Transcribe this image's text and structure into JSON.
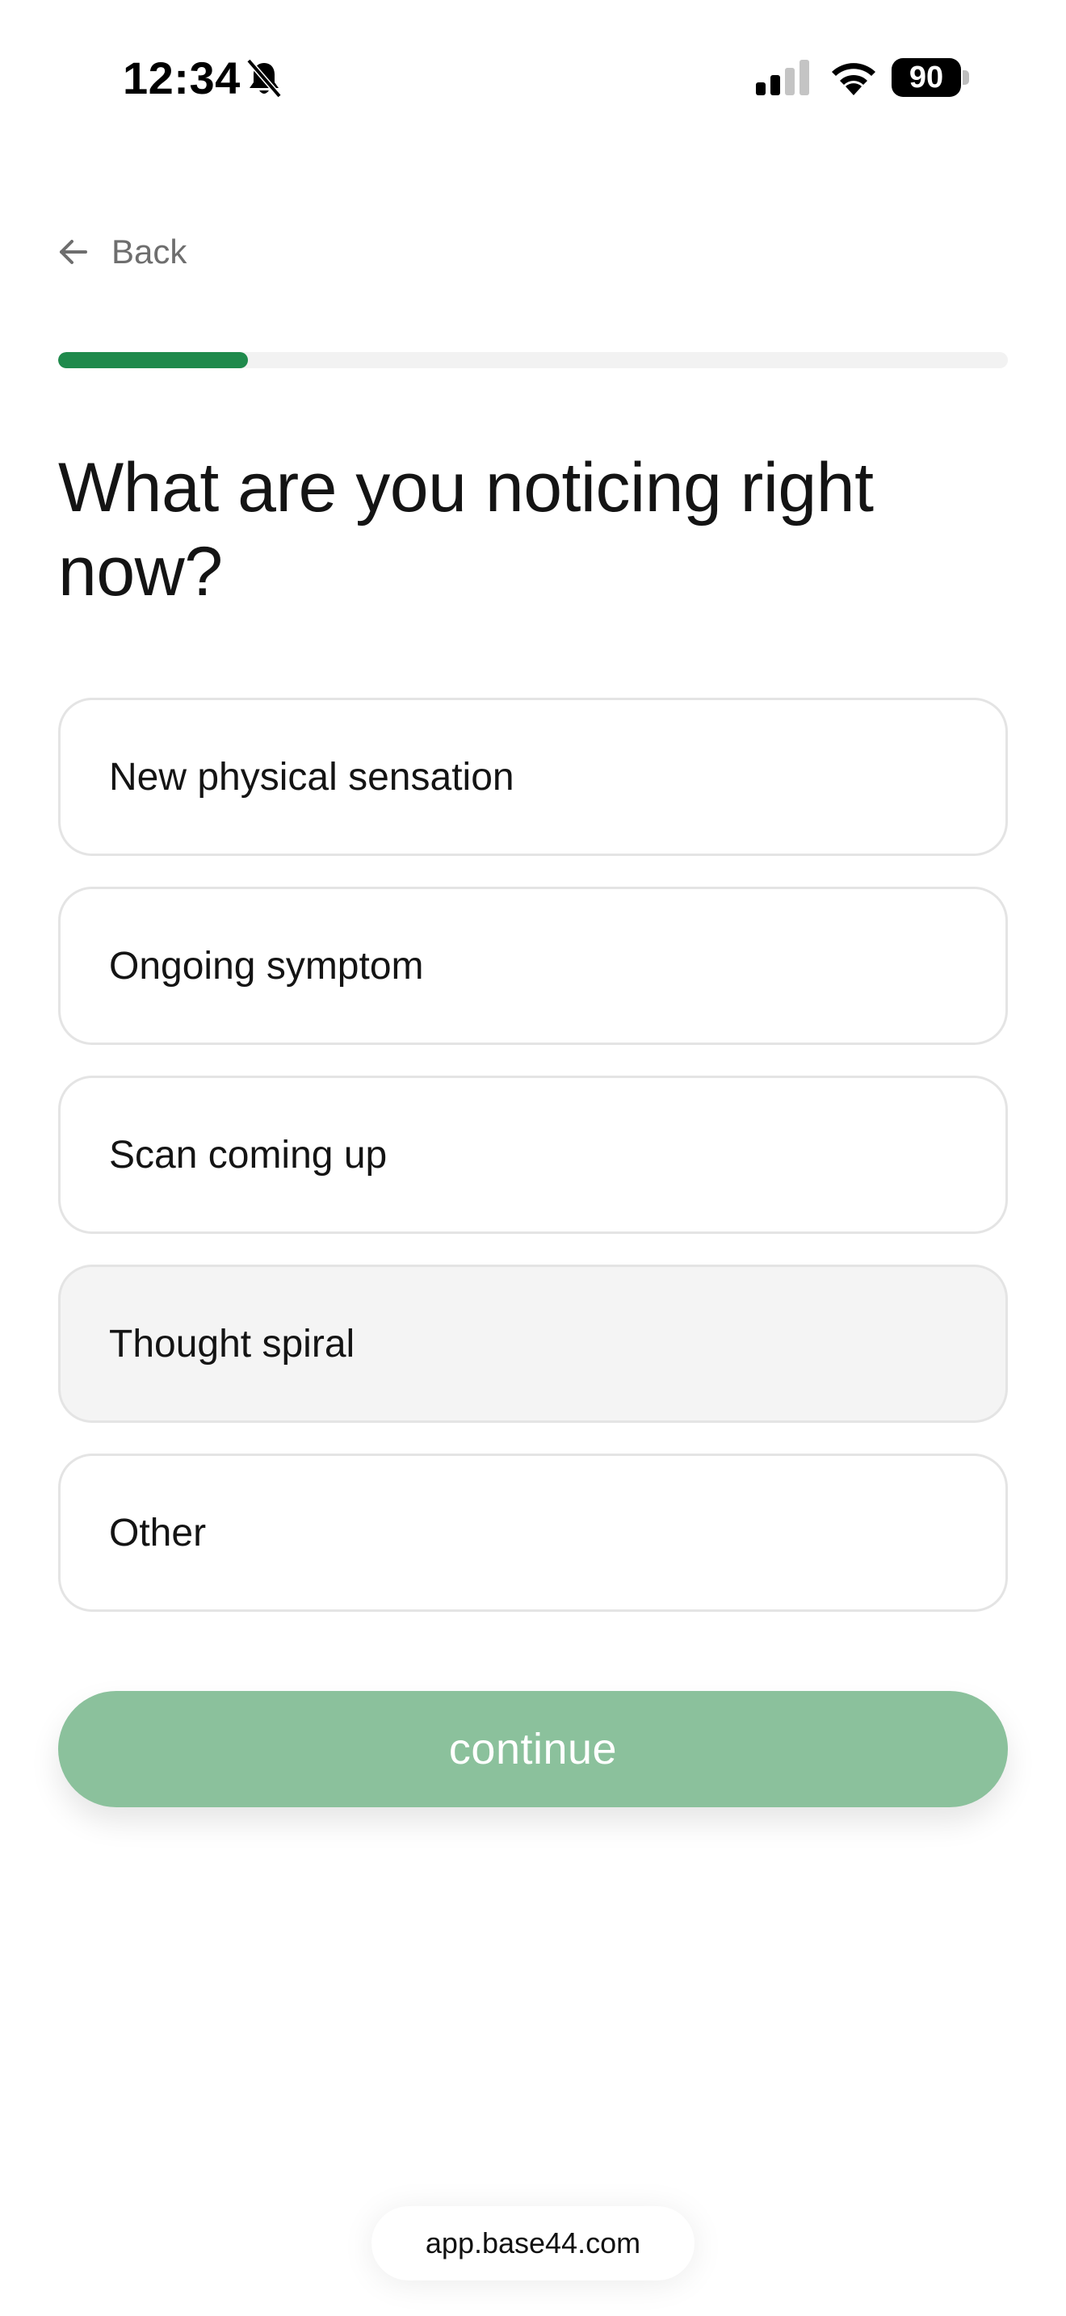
{
  "status_bar": {
    "time": "12:34",
    "battery": "90",
    "icons": [
      "bell-slash-icon",
      "cellular-signal-icon",
      "wifi-icon",
      "battery-icon"
    ]
  },
  "nav": {
    "back_label": "Back",
    "back_icon": "arrow-left-icon"
  },
  "progress": {
    "value": 0.2,
    "fill_color": "#1f8a4c",
    "track_color": "#f2f2f2"
  },
  "question": {
    "title": "What are you noticing right now?"
  },
  "options": [
    {
      "label": "New physical sensation",
      "selected": false
    },
    {
      "label": "Ongoing symptom",
      "selected": false
    },
    {
      "label": "Scan coming up",
      "selected": false
    },
    {
      "label": "Thought spiral",
      "selected": true
    },
    {
      "label": "Other",
      "selected": false
    }
  ],
  "continue": {
    "label": "continue",
    "color": "#8bc19c"
  },
  "browser": {
    "url": "app.base44.com"
  }
}
